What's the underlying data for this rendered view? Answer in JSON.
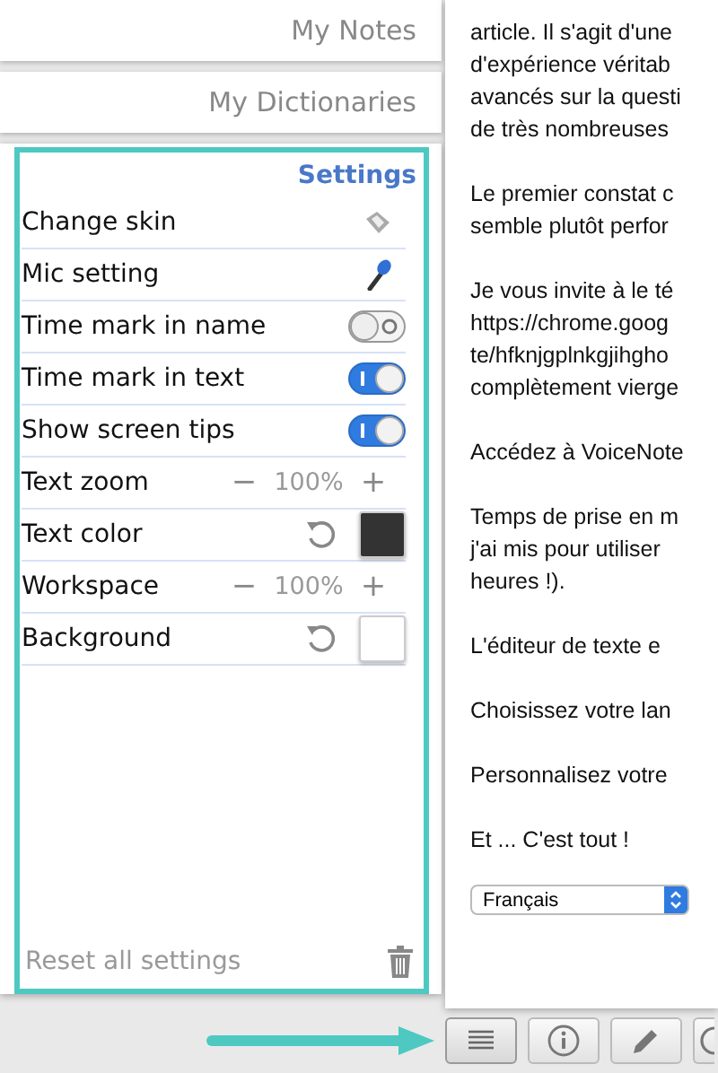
{
  "nav_tabs": [
    {
      "label": "My Notes"
    },
    {
      "label": "My Dictionaries"
    }
  ],
  "settings": {
    "title": "Settings",
    "rows": [
      {
        "kind": "icon",
        "label": "Change skin"
      },
      {
        "kind": "icon",
        "label": "Mic setting"
      },
      {
        "kind": "toggle",
        "label": "Time mark in name",
        "on": false
      },
      {
        "kind": "toggle",
        "label": "Time mark in text",
        "on": true
      },
      {
        "kind": "toggle",
        "label": "Show screen tips",
        "on": true
      },
      {
        "kind": "stepper",
        "label": "Text zoom",
        "minus": "−",
        "value": "100%",
        "plus": "+"
      },
      {
        "kind": "color",
        "label": "Text color",
        "color": "#333333"
      },
      {
        "kind": "stepper",
        "label": "Workspace",
        "minus": "−",
        "value": "100%",
        "plus": "+"
      },
      {
        "kind": "color",
        "label": "Background",
        "color": "#ffffff"
      }
    ],
    "reset": "Reset all settings"
  },
  "document": {
    "paragraphs": [
      [
        "article. Il s'agit d'une",
        "d'expérience véritab",
        "avancés sur la questi",
        "de très nombreuses"
      ],
      [
        "Le premier constat c",
        "semble plutôt perfor"
      ],
      [
        "Je vous invite à le té",
        "https://chrome.goog",
        "te/hfknjgplnkgjihgho",
        "complètement vierge"
      ],
      [
        "Accédez à VoiceNote"
      ],
      [
        "Temps de prise en m",
        "j'ai mis pour utiliser",
        "heures !)."
      ],
      [
        "L'éditeur de texte e"
      ],
      [
        "Choisissez votre lan"
      ],
      [
        "Personnalisez votre"
      ],
      [
        "Et ...  C'est tout !"
      ]
    ],
    "language": "Français"
  },
  "toolbar": [
    {
      "selected": true
    },
    {
      "selected": false
    },
    {
      "selected": false
    },
    {
      "selected": false
    }
  ]
}
